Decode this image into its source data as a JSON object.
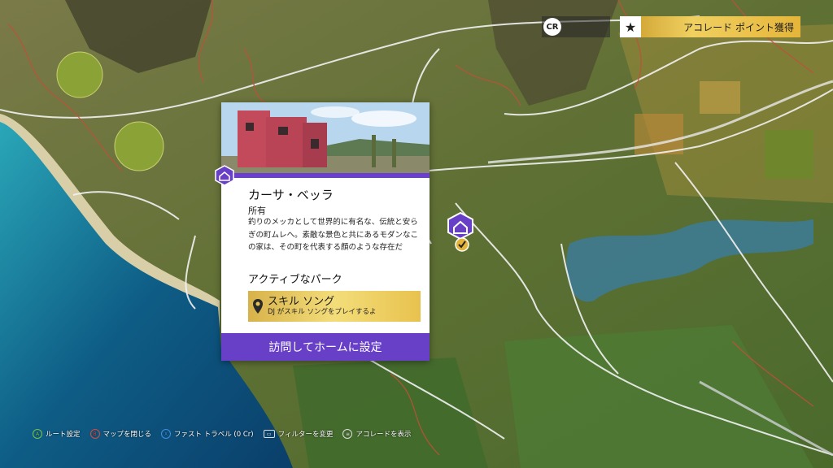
{
  "hud": {
    "cr_icon": "CR",
    "accolade_icon": "star-icon",
    "accolade_label": "アコレード ポイント獲得"
  },
  "card": {
    "title": "カーサ・ベッラ",
    "status": "所有",
    "description": "釣りのメッカとして世界的に有名な、伝統と安らぎの町ムレヘ。素敵な景色と共にあるモダンなこの家は、その町を代表する顔のような存在だ",
    "perk_heading": "アクティブなパーク",
    "perk": {
      "name": "スキル ソング",
      "description": "DJ がスキル ソングをプレイするよ"
    },
    "action_label": "訪問してホームに設定"
  },
  "controls": [
    {
      "button": "A",
      "color": "#7ac143",
      "label": "ルート設定"
    },
    {
      "button": "B",
      "color": "#e0463a",
      "label": "マップを閉じる"
    },
    {
      "button": "X",
      "color": "#3d8fe0",
      "label": "ファスト トラベル (0 Cr)"
    },
    {
      "button": "▭",
      "color": "#dddddd",
      "label": "フィルターを変更"
    },
    {
      "button": "≡",
      "color": "#dddddd",
      "label": "アコレードを表示"
    }
  ],
  "colors": {
    "accent_purple": "#6840c8",
    "gold": "#e5b53a"
  }
}
